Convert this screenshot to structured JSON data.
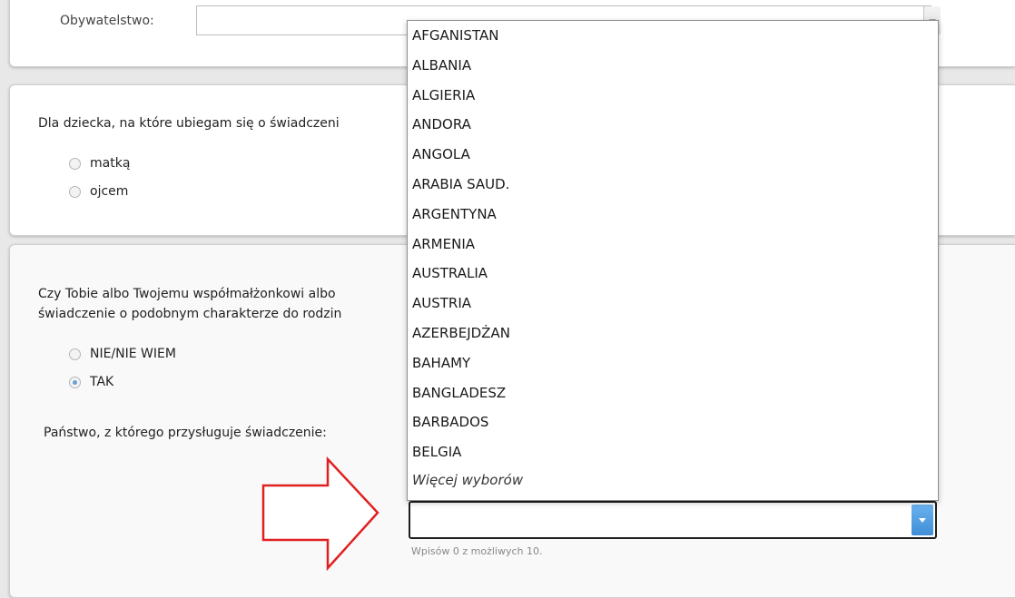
{
  "section_citizenship": {
    "label": "Obywatelstwo:",
    "value": ""
  },
  "section_parent": {
    "question": "Dla dziecka, na które ubiegam się o świadczeni",
    "options": [
      {
        "label": "matką",
        "selected": false
      },
      {
        "label": "ojcem",
        "selected": false
      }
    ]
  },
  "section_benefit": {
    "question_line1": "Czy Tobie albo Twojemu współmałżonkowi albo",
    "question_line2": "świadczenie o podobnym charakterze do rodzin",
    "options": [
      {
        "label": "NIE/NIE WIEM",
        "selected": false
      },
      {
        "label": "TAK",
        "selected": true
      }
    ],
    "country_label": "Państwo, z którego przysługuje świadczenie:",
    "country_input_value": "",
    "entries_hint": "Wpisów 0 z możliwych 10."
  },
  "dropdown": {
    "items": [
      "AFGANISTAN",
      "ALBANIA",
      "ALGIERIA",
      "ANDORA",
      "ANGOLA",
      "ARABIA SAUD.",
      "ARGENTYNA",
      "ARMENIA",
      "AUSTRALIA",
      "AUSTRIA",
      "AZERBEJDŻAN",
      "BAHAMY",
      "BANGLADESZ",
      "BARBADOS",
      "BELGIA"
    ],
    "more_label": "Więcej wyborów"
  },
  "colors": {
    "annotation_arrow": "#e02020",
    "combo_button": "#4a98dc"
  },
  "icons": {
    "combo_button": "chevron-down-icon",
    "annotation": "right-arrow-icon"
  }
}
